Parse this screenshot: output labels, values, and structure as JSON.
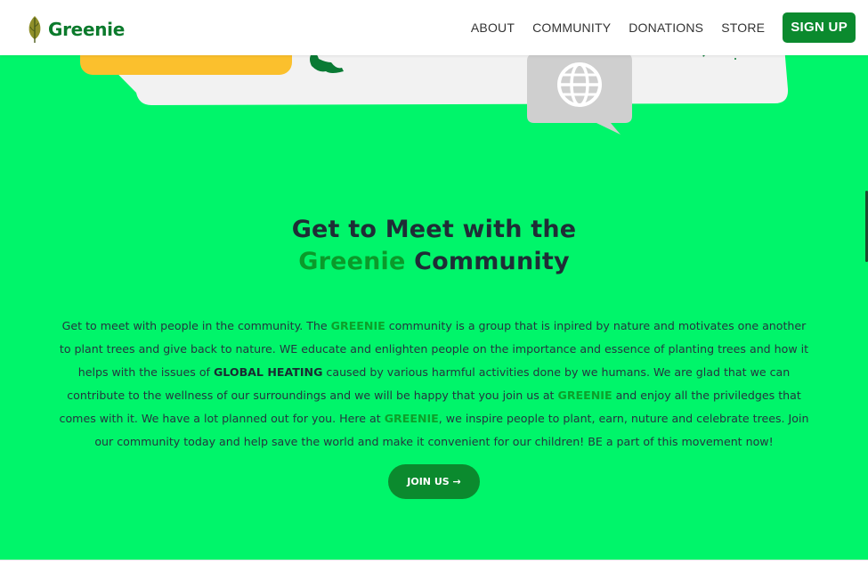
{
  "header": {
    "logo_text": "Greenie",
    "nav": [
      "ABOUT",
      "COMMUNITY",
      "DONATIONS",
      "STORE"
    ],
    "signup_label": "SIGN UP"
  },
  "heading": {
    "line1": "Get to Meet with the",
    "line2_highlight": "Greenie",
    "line2_rest": " Community"
  },
  "body": {
    "t1": "Get to meet with people in the community. The ",
    "b1": "GREENIE",
    "t2": " community is a group that is inpired by nature and motivates one another to plant trees and give back to nature. WE educate and enlighten people on the importance and essence of planting trees and how it helps with the issues of ",
    "b2": "GLOBAL HEATING",
    "t3": " caused by various harmful activities done by we humans. We are glad that we can contribute to the wellness of our surroundings and we will be happy that you join us at ",
    "b3": "GREENIE",
    "t4": " and enjoy all the priviledges that comes with it. We have a lot planned out for you. Here at ",
    "b4": "GREENIE",
    "t5": ", we inspire people to plant, earn, nuture and celebrate trees. Join our community today and help save the world and make it convenient for our children! BE a part of this movement now!"
  },
  "cta": {
    "label": "JOIN US →"
  },
  "colors": {
    "background": "#00f56a",
    "brand_green": "#0b8a2e",
    "highlight_green": "#0b9a2a",
    "accent_yellow": "#fbc02d"
  },
  "icons": [
    "leaf-logo-icon",
    "globe-chat-icon",
    "map-fragment-icon"
  ]
}
